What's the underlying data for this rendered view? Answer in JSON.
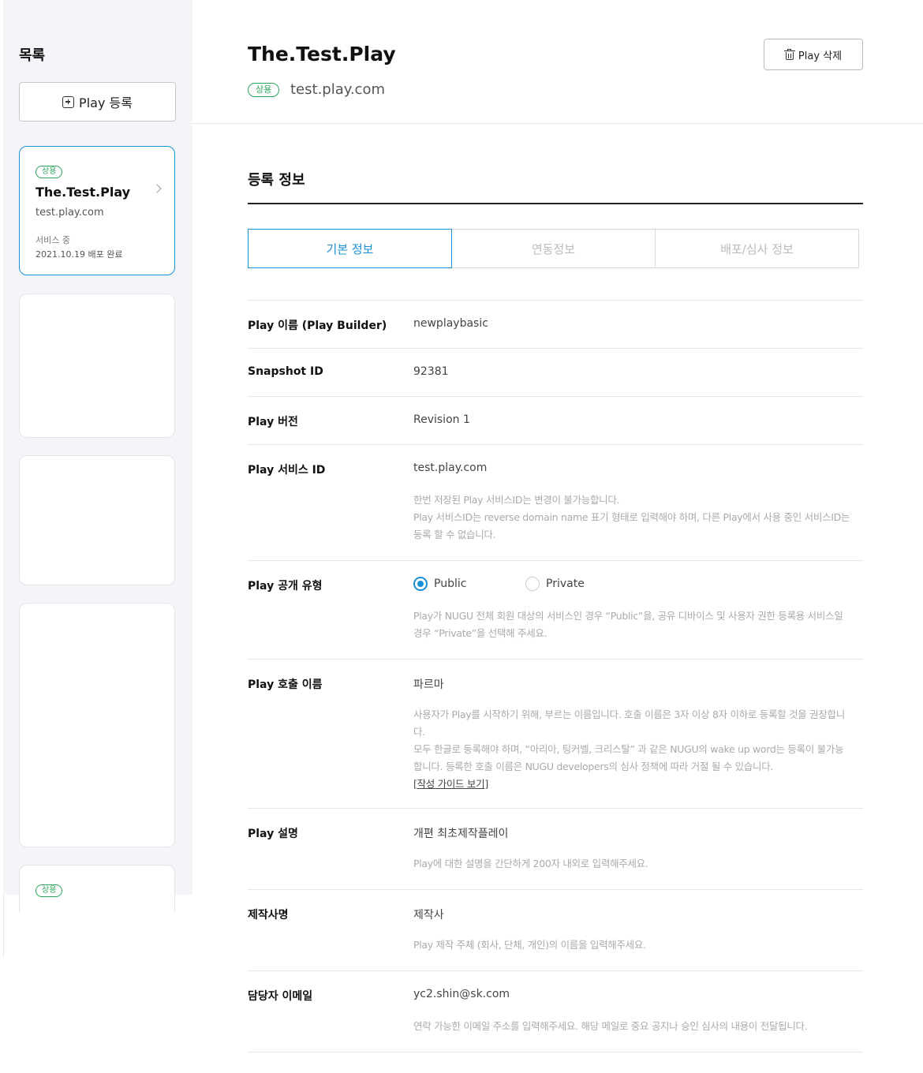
{
  "sidebar": {
    "title": "목록",
    "add_button_label": "Play 등록",
    "cards": [
      {
        "badge": "상용",
        "title": "The.Test.Play",
        "url": "test.play.com",
        "status": "서비스 중",
        "date": "2021.10.19 배포 완료"
      },
      {
        "badge": "상용"
      }
    ]
  },
  "header": {
    "title": "The.Test.Play",
    "badge": "상용",
    "url": "test.play.com",
    "delete_button_label": "Play 삭제"
  },
  "section": {
    "title": "등록 정보",
    "tabs": [
      {
        "label": "기본 정보",
        "active": true
      },
      {
        "label": "연동정보",
        "active": false
      },
      {
        "label": "배포/심사 정보",
        "active": false
      }
    ]
  },
  "fields": {
    "builder_name": {
      "label": "Play 이름 (Play Builder)",
      "value": "newplaybasic"
    },
    "snapshot_id": {
      "label": "Snapshot ID",
      "value": "92381"
    },
    "version": {
      "label": "Play 버전",
      "value": "Revision 1"
    },
    "service_id": {
      "label": "Play 서비스 ID",
      "value": "test.play.com",
      "help_1": "한번 저장된 Play 서비스ID는 변경이 불가능합니다.",
      "help_2": "Play 서비스ID는 reverse domain name 표기 형태로 입력해야 하며, 다른 Play에서 사용 중인 서비스ID는",
      "help_3": "등록 할 수 없습니다."
    },
    "visibility": {
      "label": "Play 공개 유형",
      "options": [
        "Public",
        "Private"
      ],
      "selected": "Public",
      "help_1": "Play가 NUGU 전체 회원 대상의 서비스인 경우 “Public”을, 공유 디바이스 및 사용자 권한 등록용 서비스일",
      "help_2": "경우 “Private”을 선택해 주세요."
    },
    "invocation": {
      "label": "Play 호출 이름",
      "value": "파르마",
      "help_1": "사용자가 Play를 시작하기 위해, 부르는 이름입니다. 호출 이름은 3자 이상 8자 이하로 등록할 것을 권장합니",
      "help_2": "다.",
      "help_3": "모두 한글로 등록해야 하며, “아리아, 팅커벨, 크리스탈” 과 같은 NUGU의 wake up word는 등록이 불가능",
      "help_4": "합니다. 등록한 호출 이름은 NUGU developers의 심사 정책에 따라 거절 될 수 있습니다.",
      "guide_open": "[",
      "guide_link": "작성 가이드 보기",
      "guide_close": "]"
    },
    "description": {
      "label": "Play 설명",
      "value": "개편 최초제작플레이",
      "help": "Play에 대한 설명을 간단하게 200자 내외로 입력해주세요."
    },
    "maker": {
      "label": "제작사명",
      "value": "제작사",
      "help": "Play 제작 주체 (회사, 단체, 개인)의 이름을 입력해주세요."
    },
    "email": {
      "label": "담당자 이메일",
      "value": "yc2.shin@sk.com",
      "help": "연락 가능한 이메일 주소를 입력해주세요. 해당 메일로 중요 공지나 승인 심사의 내용이 전달됩니다."
    }
  },
  "colors": {
    "accent": "#1a90d6",
    "badge": "#2ca55a",
    "sidebar_bg": "#f4f5f8"
  }
}
